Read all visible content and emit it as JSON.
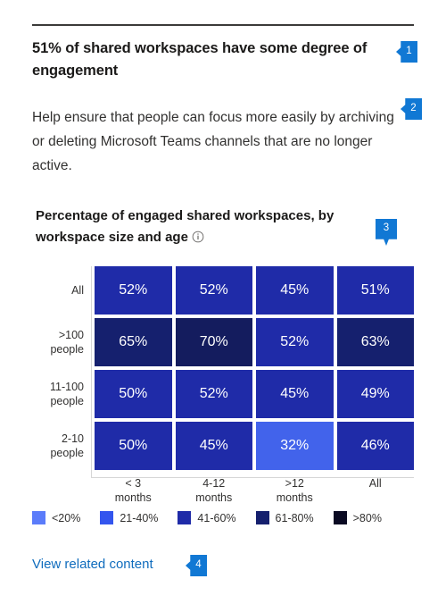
{
  "card": {
    "headline": "51% of shared workspaces have some degree of engagement",
    "body": "Help ensure that people can focus more easily by archiving or deleting Microsoft Teams channels that are no longer active.",
    "related_link": "View related content",
    "info_icon": "info-circle-icon",
    "accent_color": "#0f6cbd",
    "badge_color": "#1178d4"
  },
  "badges": [
    {
      "label": "1",
      "name": "callout-badge-1"
    },
    {
      "label": "2",
      "name": "callout-badge-2"
    },
    {
      "label": "3",
      "name": "callout-badge-3"
    },
    {
      "label": "4",
      "name": "callout-badge-4"
    }
  ],
  "chart_data": {
    "type": "heatmap",
    "title": "Percentage of engaged shared workspaces, by workspace size and age",
    "xlabel": "",
    "ylabel": "",
    "categories": [
      "< 3\nmonths",
      "4-12\nmonths",
      ">12\nmonths",
      "All"
    ],
    "rows": [
      "All",
      ">100\npeople",
      "11-100\npeople",
      "2-10\npeople"
    ],
    "values": [
      [
        52,
        52,
        45,
        51
      ],
      [
        65,
        70,
        52,
        63
      ],
      [
        50,
        52,
        45,
        49
      ],
      [
        50,
        45,
        32,
        46
      ]
    ],
    "cell_labels": [
      [
        "52%",
        "52%",
        "45%",
        "51%"
      ],
      [
        "65%",
        "70%",
        "52%",
        "63%"
      ],
      [
        "50%",
        "52%",
        "45%",
        "49%"
      ],
      [
        "50%",
        "45%",
        "32%",
        "46%"
      ]
    ],
    "cell_colors": [
      [
        "#1f2ba8",
        "#1f2ba8",
        "#1f2ba8",
        "#1f2ba8"
      ],
      [
        "#15206e",
        "#141c5e",
        "#1f2ba8",
        "#15206e"
      ],
      [
        "#1f2ba8",
        "#1f2ba8",
        "#1f2ba8",
        "#1f2ba8"
      ],
      [
        "#1f2ba8",
        "#1f2ba8",
        "#4263eb",
        "#1f2ba8"
      ]
    ],
    "legend_position": "bottom",
    "legend": [
      {
        "label": "<20%",
        "color": "#5b7cfa"
      },
      {
        "label": "21-40%",
        "color": "#3355ee"
      },
      {
        "label": "41-60%",
        "color": "#1f2ba8"
      },
      {
        "label": "61-80%",
        "color": "#15206e"
      },
      {
        "label": ">80%",
        "color": "#0a0a23"
      }
    ],
    "grid": false
  }
}
